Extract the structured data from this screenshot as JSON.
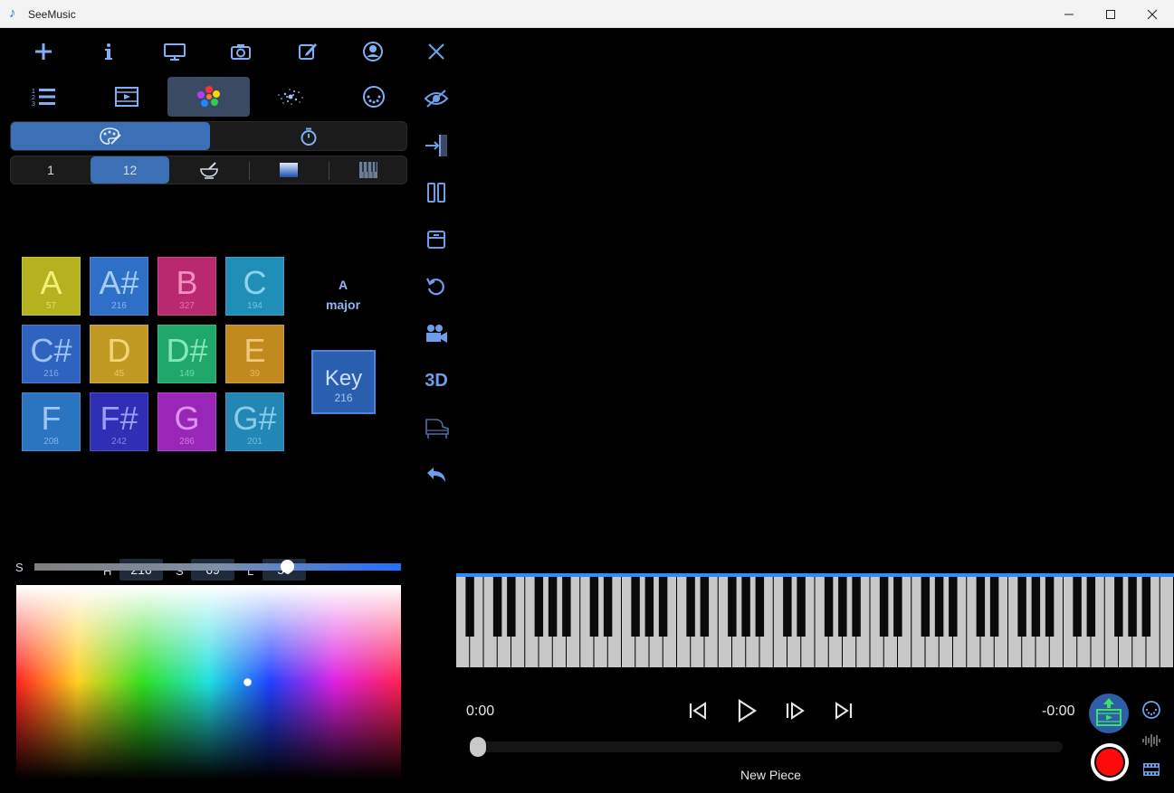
{
  "window": {
    "title": "SeeMusic",
    "app_icon": "music-note-icon",
    "controls": [
      "minimize-icon",
      "maximize-icon",
      "close-icon"
    ]
  },
  "toolbar_top": [
    "add-icon",
    "info-icon",
    "monitor-icon",
    "camera-icon",
    "edit-icon",
    "account-icon"
  ],
  "tabs": [
    "list-icon",
    "film-icon",
    "color-palette-icon",
    "particles-icon",
    "midi-port-icon"
  ],
  "mode_toggle": {
    "left": "palette-icon",
    "right": "timer-icon",
    "active": "left"
  },
  "color_modes": {
    "items": [
      "1",
      "12"
    ],
    "active": "12",
    "icon_items": [
      "mortar-icon",
      "gradient-icon",
      "keyboard-icon"
    ]
  },
  "notes": [
    {
      "name": "A",
      "value": "57",
      "color": "#b5b21f",
      "text": "#f2ef7a"
    },
    {
      "name": "A#",
      "value": "216",
      "color": "#2e6fc7",
      "text": "#a9cbf5"
    },
    {
      "name": "B",
      "value": "327",
      "color": "#b8296f",
      "text": "#f28fbe"
    },
    {
      "name": "C",
      "value": "194",
      "color": "#1f8fb8",
      "text": "#8ed3ee"
    },
    {
      "name": "C#",
      "value": "216",
      "color": "#2e63c0",
      "text": "#9dc1f2"
    },
    {
      "name": "D",
      "value": "45",
      "color": "#c09a22",
      "text": "#f3d67a"
    },
    {
      "name": "D#",
      "value": "149",
      "color": "#1fa86a",
      "text": "#86e8b9"
    },
    {
      "name": "E",
      "value": "39",
      "color": "#c08a1f",
      "text": "#f3c77a"
    },
    {
      "name": "F",
      "value": "208",
      "color": "#2b74c0",
      "text": "#9ec8f2"
    },
    {
      "name": "F#",
      "value": "242",
      "color": "#2f2fb5",
      "text": "#9d9df2"
    },
    {
      "name": "G",
      "value": "286",
      "color": "#9a26b8",
      "text": "#de92f0"
    },
    {
      "name": "G#",
      "value": "201",
      "color": "#2287b5",
      "text": "#8ccbe8"
    }
  ],
  "key_info": {
    "root": "A",
    "mode": "major",
    "key_label": "Key",
    "key_value": "216"
  },
  "hsl": {
    "h_label": "H",
    "h": "216",
    "s_label": "S",
    "s": "69",
    "l_label": "L",
    "l": "50"
  },
  "saturation": {
    "label": "S",
    "value": 0.69
  },
  "color_picker": {
    "hue_fraction": 0.6,
    "lightness_fraction": 0.5
  },
  "right_rail": [
    "close-icon",
    "eye-off-icon",
    "collapse-right-icon",
    "pause-icon",
    "save-icon",
    "reset-icon",
    "video-camera-icon",
    "3D",
    "piano-icon",
    "undo-icon"
  ],
  "transport": {
    "time_elapsed": "0:00",
    "time_remaining": "-0:00",
    "buttons": [
      "skip-start-icon",
      "play-icon",
      "step-forward-icon",
      "skip-end-icon"
    ],
    "progress": 0,
    "piece_name": "New Piece"
  },
  "bottom_right": [
    "export-video-icon",
    "record-icon",
    "midi-small-icon",
    "waveform-icon",
    "film-strip-icon"
  ]
}
